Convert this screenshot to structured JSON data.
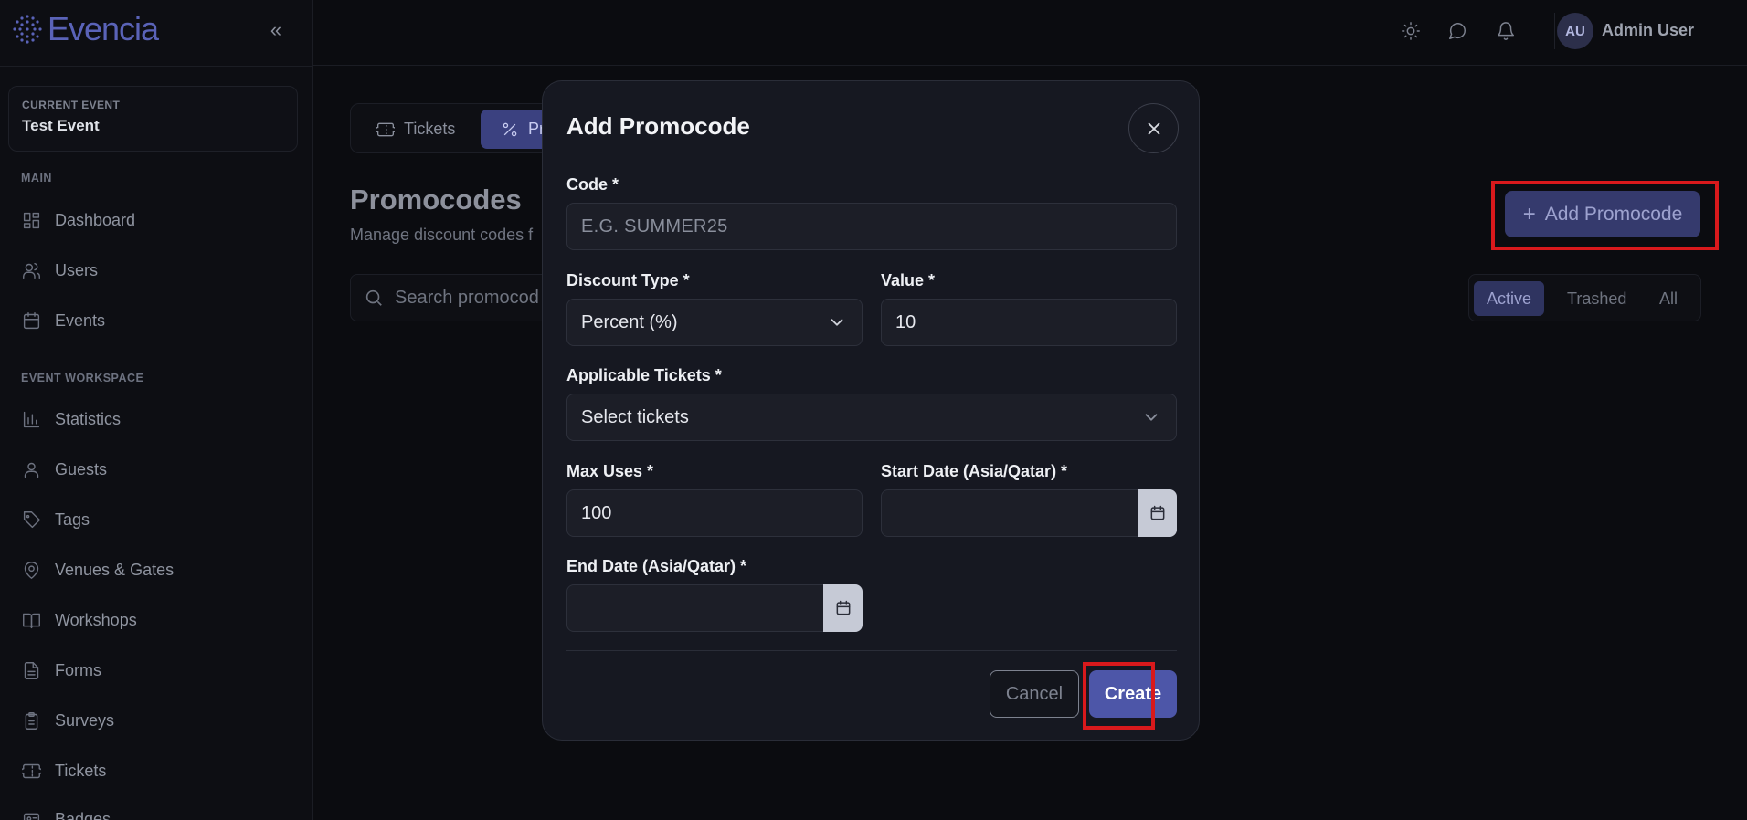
{
  "brand": {
    "name": "Evencia"
  },
  "sidebar": {
    "collapse_glyph": "«",
    "current_event_label": "CURRENT EVENT",
    "current_event_name": "Test Event",
    "main_heading": "MAIN",
    "main_items": [
      {
        "label": "Dashboard",
        "icon": "dashboard-icon"
      },
      {
        "label": "Users",
        "icon": "users-icon"
      },
      {
        "label": "Events",
        "icon": "calendar-icon"
      }
    ],
    "workspace_heading": "EVENT WORKSPACE",
    "workspace_items": [
      {
        "label": "Statistics",
        "icon": "bar-chart-icon"
      },
      {
        "label": "Guests",
        "icon": "user-icon"
      },
      {
        "label": "Tags",
        "icon": "tag-icon"
      },
      {
        "label": "Venues & Gates",
        "icon": "map-pin-icon"
      },
      {
        "label": "Workshops",
        "icon": "book-icon"
      },
      {
        "label": "Forms",
        "icon": "file-text-icon"
      },
      {
        "label": "Surveys",
        "icon": "clipboard-icon"
      },
      {
        "label": "Tickets",
        "icon": "ticket-icon"
      },
      {
        "label": "Badges",
        "icon": "badge-icon"
      }
    ]
  },
  "topbar": {
    "user_initials": "AU",
    "user_name": "Admin User"
  },
  "main": {
    "tabs": [
      {
        "label": "Tickets",
        "active": false
      },
      {
        "label": "Pr",
        "active": true
      }
    ],
    "title": "Promocodes",
    "subtitle": "Manage discount codes f",
    "search_placeholder": "Search promocod",
    "add_button": "Add Promocode",
    "filters": [
      {
        "label": "Active",
        "active": true
      },
      {
        "label": "Trashed",
        "active": false
      },
      {
        "label": "All",
        "active": false
      }
    ]
  },
  "modal": {
    "title": "Add Promocode",
    "code_label": "Code *",
    "code_placeholder": "E.G. SUMMER25",
    "discount_type_label": "Discount Type *",
    "discount_type_value": "Percent (%)",
    "value_label": "Value *",
    "value_value": "10",
    "tickets_label": "Applicable Tickets *",
    "tickets_value": "Select tickets",
    "max_uses_label": "Max Uses *",
    "max_uses_value": "100",
    "start_date_label": "Start Date (Asia/Qatar) *",
    "start_date_value": "",
    "end_date_label": "End Date (Asia/Qatar) *",
    "end_date_value": "",
    "cancel_label": "Cancel",
    "create_label": "Create"
  },
  "colors": {
    "accent": "#4d56a8",
    "highlight": "#d9191c",
    "background": "#0b0c10",
    "modal_bg": "#161821"
  }
}
